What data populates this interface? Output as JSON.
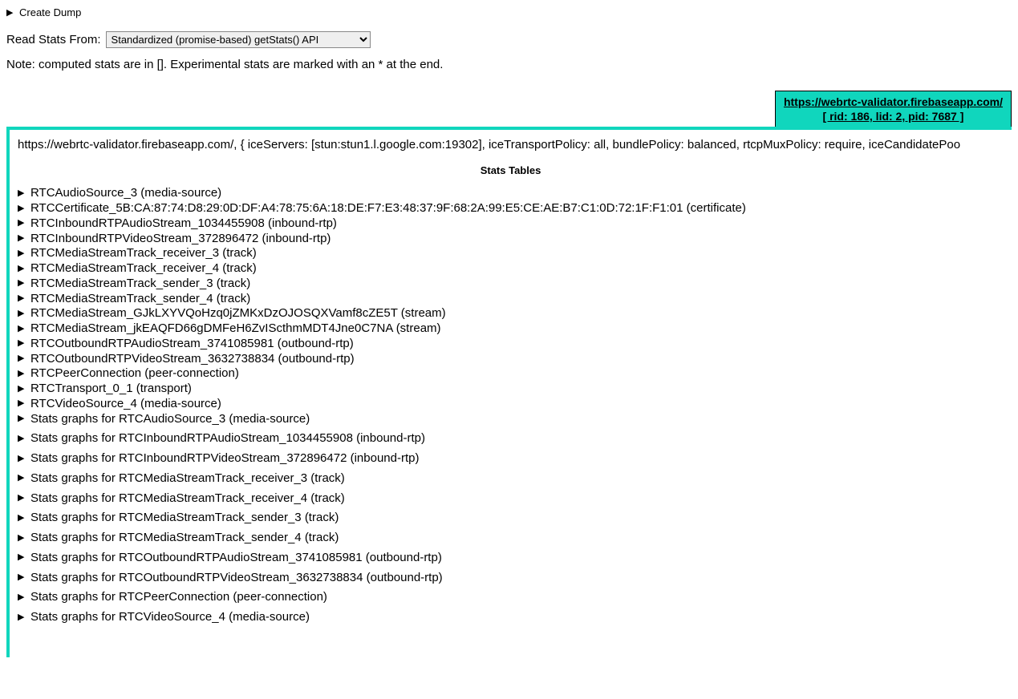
{
  "header": {
    "create_dump": "Create Dump",
    "read_stats_label": "Read Stats From:",
    "read_stats_selected": "Standardized (promise-based) getStats() API",
    "note": "Note: computed stats are in []. Experimental stats are marked with an * at the end."
  },
  "tab": {
    "url": "https://webrtc-validator.firebaseapp.com/",
    "ids": "[ rid: 186, lid: 2, pid: 7687 ]"
  },
  "panel": {
    "config_line": "https://webrtc-validator.firebaseapp.com/, { iceServers: [stun:stun1.l.google.com:19302], iceTransportPolicy: all, bundlePolicy: balanced, rtcpMuxPolicy: require, iceCandidatePoo",
    "stats_heading": "Stats Tables",
    "stats_items": [
      {
        "label": "RTCAudioSource_3 (media-source)",
        "spaced": false
      },
      {
        "label": "RTCCertificate_5B:CA:87:74:D8:29:0D:DF:A4:78:75:6A:18:DE:F7:E3:48:37:9F:68:2A:99:E5:CE:AE:B7:C1:0D:72:1F:F1:01 (certificate)",
        "spaced": false
      },
      {
        "label": "RTCInboundRTPAudioStream_1034455908 (inbound-rtp)",
        "spaced": false
      },
      {
        "label": "RTCInboundRTPVideoStream_372896472 (inbound-rtp)",
        "spaced": false
      },
      {
        "label": "RTCMediaStreamTrack_receiver_3 (track)",
        "spaced": false
      },
      {
        "label": "RTCMediaStreamTrack_receiver_4 (track)",
        "spaced": false
      },
      {
        "label": "RTCMediaStreamTrack_sender_3 (track)",
        "spaced": false
      },
      {
        "label": "RTCMediaStreamTrack_sender_4 (track)",
        "spaced": false
      },
      {
        "label": "RTCMediaStream_GJkLXYVQoHzq0jZMKxDzOJOSQXVamf8cZE5T (stream)",
        "spaced": false
      },
      {
        "label": "RTCMediaStream_jkEAQFD66gDMFeH6ZvIScthmMDT4Jne0C7NA (stream)",
        "spaced": false
      },
      {
        "label": "RTCOutboundRTPAudioStream_3741085981 (outbound-rtp)",
        "spaced": false
      },
      {
        "label": "RTCOutboundRTPVideoStream_3632738834 (outbound-rtp)",
        "spaced": false
      },
      {
        "label": "RTCPeerConnection (peer-connection)",
        "spaced": false
      },
      {
        "label": "RTCTransport_0_1 (transport)",
        "spaced": false
      },
      {
        "label": "RTCVideoSource_4 (media-source)",
        "spaced": false
      },
      {
        "label": "Stats graphs for RTCAudioSource_3 (media-source)",
        "spaced": false
      },
      {
        "label": "Stats graphs for RTCInboundRTPAudioStream_1034455908 (inbound-rtp)",
        "spaced": true
      },
      {
        "label": "Stats graphs for RTCInboundRTPVideoStream_372896472 (inbound-rtp)",
        "spaced": true
      },
      {
        "label": "Stats graphs for RTCMediaStreamTrack_receiver_3 (track)",
        "spaced": true
      },
      {
        "label": "Stats graphs for RTCMediaStreamTrack_receiver_4 (track)",
        "spaced": true
      },
      {
        "label": "Stats graphs for RTCMediaStreamTrack_sender_3 (track)",
        "spaced": true
      },
      {
        "label": "Stats graphs for RTCMediaStreamTrack_sender_4 (track)",
        "spaced": true
      },
      {
        "label": "Stats graphs for RTCOutboundRTPAudioStream_3741085981 (outbound-rtp)",
        "spaced": true
      },
      {
        "label": "Stats graphs for RTCOutboundRTPVideoStream_3632738834 (outbound-rtp)",
        "spaced": true
      },
      {
        "label": "Stats graphs for RTCPeerConnection (peer-connection)",
        "spaced": true
      },
      {
        "label": "Stats graphs for RTCVideoSource_4 (media-source)",
        "spaced": true
      }
    ]
  }
}
